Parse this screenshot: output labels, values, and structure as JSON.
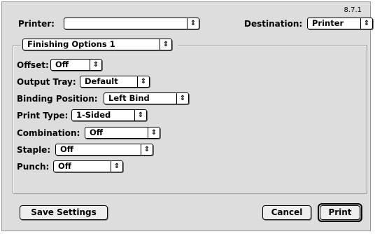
{
  "version": "8.7.1",
  "printer": {
    "label": "Printer:",
    "value": ""
  },
  "destination": {
    "label": "Destination:",
    "value": "Printer"
  },
  "panel_select": {
    "value": "Finishing Options 1"
  },
  "options": {
    "offset": {
      "label": "Offset:",
      "value": "Off"
    },
    "output_tray": {
      "label": "Output Tray:",
      "value": "Default"
    },
    "binding_position": {
      "label": "Binding Position:",
      "value": "Left Bind"
    },
    "print_type": {
      "label": "Print Type:",
      "value": "1-Sided"
    },
    "combination": {
      "label": "Combination:",
      "value": "Off"
    },
    "staple": {
      "label": "Staple:",
      "value": "Off"
    },
    "punch": {
      "label": "Punch:",
      "value": "Off"
    }
  },
  "buttons": {
    "save_settings": "Save Settings",
    "cancel": "Cancel",
    "print": "Print"
  },
  "icons": {
    "popup_arrow": "up-down-arrows-icon",
    "arrow_glyph": "⇕"
  }
}
